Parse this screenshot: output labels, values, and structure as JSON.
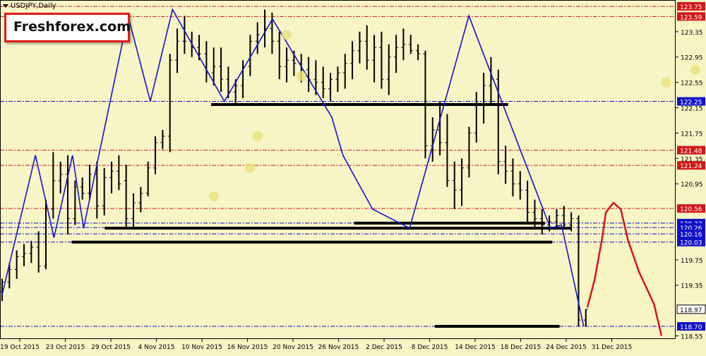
{
  "header": {
    "symbol": "USDJPY,Daily"
  },
  "brand": {
    "name": "Freshforex.com"
  },
  "colors": {
    "background": "#f7f4c6",
    "bars": "#000000",
    "zigzag": "#1414c8",
    "support": "#000000",
    "forecast": "#d01818",
    "red_level": "#d01818",
    "blue_level": "#1010c8",
    "highlight": "#e8e27a"
  },
  "chart_data": {
    "type": "ohlc",
    "price_axis": {
      "ylim": [
        118.5,
        123.85
      ],
      "ticks": [
        "123.35",
        "122.95",
        "122.55",
        "122.15",
        "121.75",
        "121.35",
        "120.95",
        "119.75",
        "119.35",
        "118.55"
      ]
    },
    "date_labels": [
      "19 Oct 2015",
      "23 Oct 2015",
      "29 Oct 2015",
      "4 Nov 2015",
      "10 Nov 2015",
      "16 Nov 2015",
      "20 Nov 2015",
      "26 Nov 2015",
      "2 Dec 2015",
      "8 Dec 2015",
      "14 Dec 2015",
      "18 Dec 2015",
      "24 Dec 2015",
      "31 Dec 2015"
    ],
    "level_labels": [
      {
        "text": "123.75",
        "value": 123.75,
        "kind": "red"
      },
      {
        "text": "123.59",
        "value": 123.59,
        "kind": "red"
      },
      {
        "text": "122.25",
        "value": 122.25,
        "kind": "blue"
      },
      {
        "text": "121.48",
        "value": 121.48,
        "kind": "red"
      },
      {
        "text": "121.24",
        "value": 121.24,
        "kind": "red"
      },
      {
        "text": "120.56",
        "value": 120.56,
        "kind": "red"
      },
      {
        "text": "120.33",
        "value": 120.33,
        "kind": "blue"
      },
      {
        "text": "120.26",
        "value": 120.26,
        "kind": "blue"
      },
      {
        "text": "120.16",
        "value": 120.16,
        "kind": "blue"
      },
      {
        "text": "120.03",
        "value": 120.03,
        "kind": "blue"
      },
      {
        "text": "118.97",
        "value": 118.97,
        "kind": "current"
      },
      {
        "text": "118.70",
        "value": 118.7,
        "kind": "blue"
      }
    ],
    "bars": [
      [
        0,
        119.25,
        119.45,
        119.1,
        119.4
      ],
      [
        1,
        119.4,
        119.7,
        119.3,
        119.6
      ],
      [
        2,
        119.6,
        119.9,
        119.45,
        119.8
      ],
      [
        3,
        119.8,
        120.0,
        119.65,
        119.85
      ],
      [
        4,
        119.85,
        120.05,
        119.7,
        119.95
      ],
      [
        5,
        119.95,
        120.2,
        119.55,
        119.65
      ],
      [
        6,
        119.65,
        120.7,
        119.6,
        120.55
      ],
      [
        7,
        120.55,
        121.45,
        120.4,
        121.0
      ],
      [
        8,
        121.0,
        121.3,
        120.8,
        121.1
      ],
      [
        9,
        121.1,
        121.4,
        120.15,
        120.4
      ],
      [
        10,
        120.4,
        121.0,
        120.3,
        120.9
      ],
      [
        11,
        120.9,
        121.05,
        120.7,
        120.8
      ],
      [
        12,
        120.8,
        121.25,
        120.7,
        121.1
      ],
      [
        13,
        121.1,
        121.3,
        120.4,
        120.6
      ],
      [
        14,
        120.6,
        121.2,
        120.45,
        121.05
      ],
      [
        15,
        121.05,
        121.3,
        120.8,
        121.15
      ],
      [
        16,
        121.15,
        121.4,
        120.85,
        120.95
      ],
      [
        17,
        121.0,
        121.25,
        120.25,
        120.4
      ],
      [
        18,
        120.4,
        120.8,
        120.25,
        120.65
      ],
      [
        19,
        120.65,
        120.9,
        120.5,
        120.8
      ],
      [
        20,
        120.8,
        121.3,
        120.75,
        121.2
      ],
      [
        21,
        121.2,
        121.7,
        121.1,
        121.6
      ],
      [
        22,
        121.6,
        121.8,
        121.5,
        121.7
      ],
      [
        23,
        121.7,
        123.0,
        121.45,
        122.9
      ],
      [
        24,
        122.9,
        123.4,
        122.7,
        123.2
      ],
      [
        25,
        123.2,
        123.6,
        123.0,
        123.2
      ],
      [
        26,
        123.2,
        123.35,
        122.95,
        123.1
      ],
      [
        27,
        123.1,
        123.3,
        122.9,
        123.0
      ],
      [
        28,
        123.0,
        123.2,
        122.55,
        122.7
      ],
      [
        29,
        122.7,
        123.1,
        122.5,
        122.8
      ],
      [
        30,
        122.8,
        123.1,
        122.4,
        122.6
      ],
      [
        31,
        122.6,
        122.8,
        122.3,
        122.4
      ],
      [
        32,
        122.4,
        122.6,
        122.2,
        122.5
      ],
      [
        33,
        122.5,
        122.9,
        122.3,
        122.8
      ],
      [
        34,
        122.8,
        123.3,
        122.65,
        123.2
      ],
      [
        35,
        123.2,
        123.5,
        123.0,
        123.3
      ],
      [
        36,
        123.3,
        123.7,
        123.1,
        123.4
      ],
      [
        37,
        123.4,
        123.65,
        123.0,
        123.2
      ],
      [
        38,
        123.2,
        123.35,
        122.6,
        122.8
      ],
      [
        39,
        122.8,
        123.1,
        122.55,
        122.9
      ],
      [
        40,
        122.9,
        123.05,
        122.65,
        122.85
      ],
      [
        41,
        122.85,
        123.0,
        122.55,
        122.75
      ],
      [
        42,
        122.75,
        122.95,
        122.4,
        122.6
      ],
      [
        43,
        122.6,
        122.9,
        122.35,
        122.55
      ],
      [
        44,
        122.55,
        122.8,
        122.3,
        122.45
      ],
      [
        45,
        122.45,
        122.7,
        122.25,
        122.6
      ],
      [
        46,
        122.6,
        122.8,
        122.4,
        122.7
      ],
      [
        47,
        122.7,
        123.0,
        122.45,
        122.85
      ],
      [
        48,
        122.85,
        123.2,
        122.6,
        123.05
      ],
      [
        49,
        123.05,
        123.35,
        122.85,
        123.2
      ],
      [
        50,
        123.2,
        123.45,
        122.75,
        122.9
      ],
      [
        51,
        122.9,
        123.3,
        122.55,
        123.1
      ],
      [
        52,
        123.1,
        123.35,
        122.45,
        122.6
      ],
      [
        53,
        122.6,
        123.15,
        122.35,
        122.95
      ],
      [
        54,
        122.95,
        123.3,
        122.7,
        123.1
      ],
      [
        55,
        123.1,
        123.4,
        122.9,
        123.15
      ],
      [
        56,
        123.15,
        123.3,
        123.0,
        123.05
      ],
      [
        57,
        123.05,
        123.15,
        122.9,
        123.0
      ],
      [
        58,
        123.0,
        123.05,
        121.35,
        121.55
      ],
      [
        59,
        121.55,
        122.0,
        121.3,
        121.8
      ],
      [
        60,
        121.8,
        122.25,
        121.4,
        121.6
      ],
      [
        61,
        121.6,
        122.05,
        120.9,
        121.0
      ],
      [
        62,
        121.0,
        121.3,
        120.55,
        120.85
      ],
      [
        63,
        120.85,
        121.35,
        120.6,
        121.2
      ],
      [
        64,
        121.2,
        121.85,
        121.05,
        121.75
      ],
      [
        65,
        121.75,
        122.4,
        121.6,
        122.2
      ],
      [
        66,
        122.2,
        122.7,
        121.9,
        122.5
      ],
      [
        67,
        122.5,
        122.95,
        122.2,
        122.6
      ],
      [
        68,
        122.6,
        122.75,
        121.1,
        121.3
      ],
      [
        69,
        121.3,
        121.55,
        120.95,
        121.15
      ],
      [
        70,
        121.15,
        121.35,
        120.75,
        120.95
      ],
      [
        71,
        120.95,
        121.15,
        120.7,
        120.85
      ],
      [
        72,
        120.85,
        121.0,
        120.35,
        120.5
      ],
      [
        73,
        120.5,
        120.7,
        120.25,
        120.4
      ],
      [
        74,
        120.4,
        120.55,
        120.15,
        120.3
      ],
      [
        75,
        120.3,
        120.45,
        120.2,
        120.35
      ],
      [
        76,
        120.35,
        120.55,
        120.25,
        120.45
      ],
      [
        77,
        120.45,
        120.6,
        120.25,
        120.3
      ],
      [
        78,
        120.3,
        120.5,
        120.2,
        120.4
      ],
      [
        79,
        120.4,
        120.45,
        118.7,
        118.8
      ],
      [
        80,
        118.8,
        118.97,
        118.7,
        118.97
      ]
    ],
    "zigzag": [
      [
        0,
        119.2
      ],
      [
        9,
        121.4
      ],
      [
        14,
        120.1
      ],
      [
        19,
        121.4
      ],
      [
        22,
        120.25
      ],
      [
        34,
        123.6
      ],
      [
        40,
        122.25
      ],
      [
        46,
        123.7
      ],
      [
        60,
        122.25
      ],
      [
        73,
        123.55
      ],
      [
        89,
        122.0
      ],
      [
        92,
        121.4
      ],
      [
        100,
        120.55
      ],
      [
        110,
        120.25
      ],
      [
        126,
        123.6
      ],
      [
        148,
        120.25
      ],
      [
        151,
        120.3
      ],
      [
        157,
        118.7
      ]
    ],
    "support_lines": [
      {
        "x1": 118,
        "x2": 152,
        "value": 118.7
      },
      {
        "x1": 19,
        "x2": 150,
        "value": 120.03
      },
      {
        "x1": 28,
        "x2": 155,
        "value": 120.25
      },
      {
        "x1": 96,
        "x2": 148,
        "value": 120.33
      },
      {
        "x1": 57,
        "x2": 138,
        "value": 122.2
      }
    ],
    "forecast_path": [
      [
        158,
        119.0
      ],
      [
        160,
        119.45
      ],
      [
        162,
        120.1
      ],
      [
        163,
        120.5
      ],
      [
        165,
        120.65
      ],
      [
        167,
        120.55
      ],
      [
        169,
        120.05
      ],
      [
        172,
        119.55
      ],
      [
        176,
        119.05
      ],
      [
        178,
        118.55
      ]
    ],
    "highlight_points": [
      [
        29,
        120.75
      ],
      [
        34,
        121.2
      ],
      [
        35,
        121.7
      ],
      [
        39,
        123.3
      ],
      [
        41,
        122.65
      ],
      [
        91,
        122.55
      ],
      [
        95,
        122.75
      ]
    ]
  }
}
